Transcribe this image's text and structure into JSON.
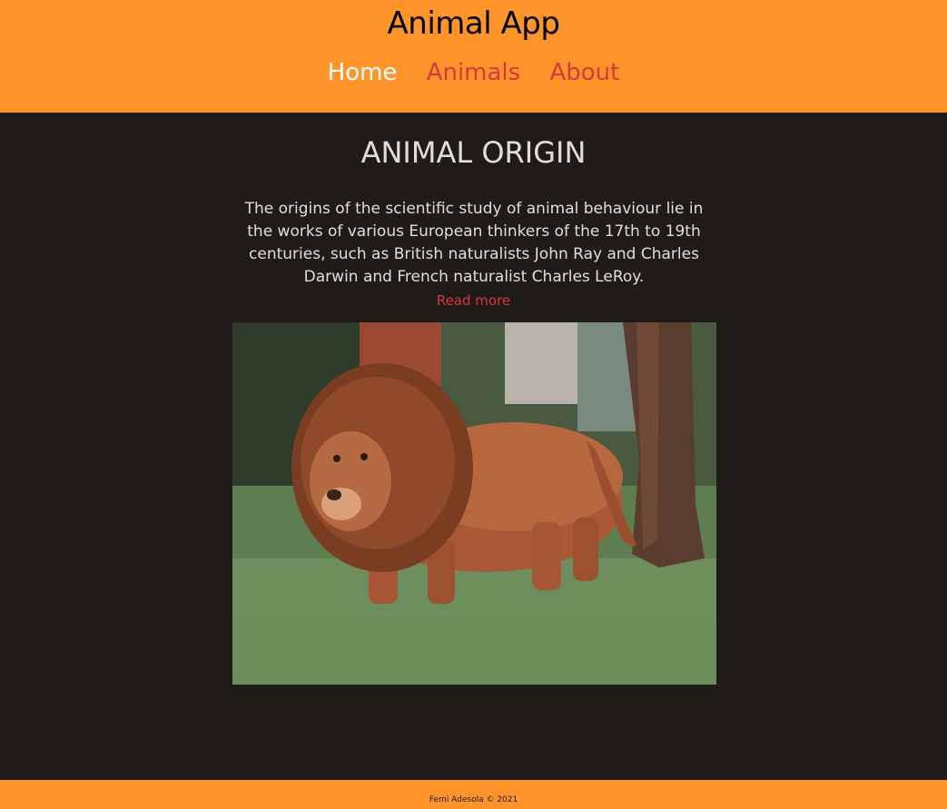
{
  "header": {
    "title": "Animal App",
    "nav": {
      "home": "Home",
      "animals": "Animals",
      "about": "About"
    }
  },
  "main": {
    "heading": "ANIMAL ORIGIN",
    "description": "The origins of the scientific study of animal behaviour lie in the works of various European thinkers of the 17th to 19th centuries, such as British naturalists John Ray and Charles Darwin and French naturalist Charles LeRoy.",
    "read_more": "Read more",
    "image_subject": "lion"
  },
  "footer": {
    "credit": "Femi Adesola © 2021"
  },
  "colors": {
    "header_bg": "#ff952a",
    "page_bg": "#1e1b19",
    "link_accent": "#d9363e",
    "text_light": "#e6dcd6"
  }
}
